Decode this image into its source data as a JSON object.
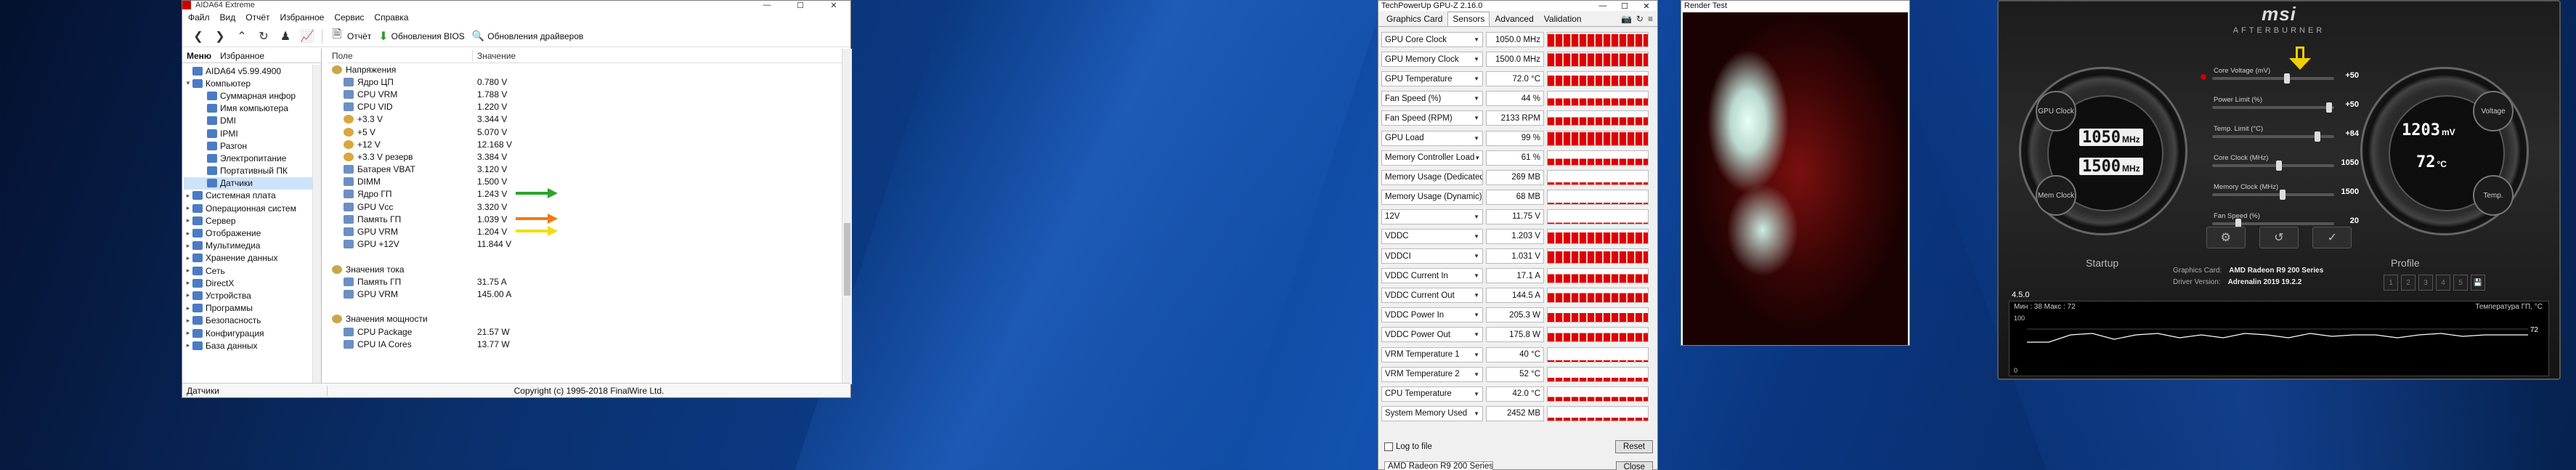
{
  "aida": {
    "title": "AIDA64 Extreme",
    "menu": [
      "Файл",
      "Вид",
      "Отчёт",
      "Избранное",
      "Сервис",
      "Справка"
    ],
    "toolbar": {
      "report": "Отчёт",
      "bios": "Обновления BIOS",
      "drivers": "Обновления драйверов"
    },
    "tabs": [
      "Меню",
      "Избранное"
    ],
    "tree": [
      {
        "label": "AIDA64 v5.99.4900",
        "exp": ""
      },
      {
        "label": "Компьютер",
        "exp": "▾"
      },
      {
        "label": "Суммарная инфор",
        "exp": "",
        "indent": 2
      },
      {
        "label": "Имя компьютера",
        "exp": "",
        "indent": 2
      },
      {
        "label": "DMI",
        "exp": "",
        "indent": 2
      },
      {
        "label": "IPMI",
        "exp": "",
        "indent": 2
      },
      {
        "label": "Разгон",
        "exp": "",
        "indent": 2
      },
      {
        "label": "Электропитание",
        "exp": "",
        "indent": 2
      },
      {
        "label": "Портативный ПК",
        "exp": "",
        "indent": 2
      },
      {
        "label": "Датчики",
        "exp": "",
        "indent": 2,
        "selected": true
      },
      {
        "label": "Системная плата",
        "exp": "▸"
      },
      {
        "label": "Операционная систем",
        "exp": "▸"
      },
      {
        "label": "Сервер",
        "exp": "▸"
      },
      {
        "label": "Отображение",
        "exp": "▸"
      },
      {
        "label": "Мультимедиа",
        "exp": "▸"
      },
      {
        "label": "Хранение данных",
        "exp": "▸"
      },
      {
        "label": "Сеть",
        "exp": "▸"
      },
      {
        "label": "DirectX",
        "exp": "▸"
      },
      {
        "label": "Устройства",
        "exp": "▸"
      },
      {
        "label": "Программы",
        "exp": "▸"
      },
      {
        "label": "Безопасность",
        "exp": "▸"
      },
      {
        "label": "Конфигурация",
        "exp": "▸"
      },
      {
        "label": "База данных",
        "exp": "▸"
      }
    ],
    "columns": {
      "field": "Поле",
      "value": "Значение"
    },
    "rows": [
      {
        "type": "sec",
        "field": "Напряжения",
        "value": ""
      },
      {
        "field": "Ядро ЦП",
        "value": "0.780 V"
      },
      {
        "field": "CPU VRM",
        "value": "1.788 V"
      },
      {
        "field": "CPU VID",
        "value": "1.220 V"
      },
      {
        "field": "+3.3 V",
        "value": "3.344 V",
        "orb": true
      },
      {
        "field": "+5 V",
        "value": "5.070 V",
        "orb": true
      },
      {
        "field": "+12 V",
        "value": "12.168 V",
        "orb": true
      },
      {
        "field": "+3.3 V резерв",
        "value": "3.384 V",
        "orb": true
      },
      {
        "field": "Батарея VBAT",
        "value": "3.120 V"
      },
      {
        "field": "DIMM",
        "value": "1.500 V"
      },
      {
        "field": "Ядро ГП",
        "value": "1.243 V",
        "arrow": "#2aa52a"
      },
      {
        "field": "GPU Vcc",
        "value": "3.320 V"
      },
      {
        "field": "Память ГП",
        "value": "1.039 V",
        "arrow": "#f07a10"
      },
      {
        "field": "GPU VRM",
        "value": "1.204 V",
        "arrow": "#f2dd10"
      },
      {
        "field": "GPU +12V",
        "value": "11.844 V"
      },
      {
        "type": "blank",
        "field": "",
        "value": ""
      },
      {
        "type": "sec",
        "field": "Значения тока",
        "value": ""
      },
      {
        "field": "Память ГП",
        "value": "31.75 A"
      },
      {
        "field": "GPU VRM",
        "value": "145.00 A"
      },
      {
        "type": "blank",
        "field": "",
        "value": ""
      },
      {
        "type": "sec",
        "field": "Значения мощности",
        "value": ""
      },
      {
        "field": "CPU Package",
        "value": "21.57 W"
      },
      {
        "field": "CPU IA Cores",
        "value": "13.77 W"
      }
    ],
    "status": {
      "left": "Датчики",
      "center": "Copyright (c) 1995-2018 FinalWire Ltd."
    }
  },
  "gpuz": {
    "title": "TechPowerUp GPU-Z 2.16.0",
    "tabs": [
      "Graphics Card",
      "Sensors",
      "Advanced",
      "Validation"
    ],
    "active_tab": "Sensors",
    "sensors": [
      {
        "name": "GPU Core Clock",
        "value": "1050.0 MHz",
        "level": 90
      },
      {
        "name": "GPU Memory Clock",
        "value": "1500.0 MHz",
        "level": 92
      },
      {
        "name": "GPU Temperature",
        "value": "72.0 °C",
        "level": 75
      },
      {
        "name": "Fan Speed (%)",
        "value": "44 %",
        "level": 50
      },
      {
        "name": "Fan Speed (RPM)",
        "value": "2133 RPM",
        "level": 55
      },
      {
        "name": "GPU Load",
        "value": "99 %",
        "level": 95
      },
      {
        "name": "Memory Controller Load",
        "value": "61 %",
        "level": 45
      },
      {
        "name": "Memory Usage (Dedicated)",
        "value": "269 MB",
        "level": 15
      },
      {
        "name": "Memory Usage (Dynamic)",
        "value": "68 MB",
        "level": 10
      },
      {
        "name": "12V",
        "value": "11.75 V",
        "level": 8
      },
      {
        "name": "VDDC",
        "value": "1.203 V",
        "level": 80
      },
      {
        "name": "VDDCI",
        "value": "1.031 V",
        "level": 85
      },
      {
        "name": "VDDC Current In",
        "value": "17.1 A",
        "level": 60
      },
      {
        "name": "VDDC Current Out",
        "value": "144.5 A",
        "level": 65
      },
      {
        "name": "VDDC Power In",
        "value": "205.3 W",
        "level": 62
      },
      {
        "name": "VDDC Power Out",
        "value": "175.8 W",
        "level": 60
      },
      {
        "name": "VRM Temperature 1",
        "value": "40 °C",
        "level": 10
      },
      {
        "name": "VRM Temperature 2",
        "value": "52 °C",
        "level": 25
      },
      {
        "name": "CPU Temperature",
        "value": "42.0 °C",
        "level": 30
      },
      {
        "name": "System Memory Used",
        "value": "2452 MB",
        "level": 20
      }
    ],
    "log_label": "Log to file",
    "reset": "Reset",
    "card_select": "AMD Radeon R9 200 Series",
    "close": "Close"
  },
  "render": {
    "title": "Render Test"
  },
  "afterburner": {
    "logo": "msi",
    "brand": "AFTERBURNER",
    "gpu_clock_label": "GPU Clock",
    "mem_clock_label": "Mem Clock",
    "voltage_label": "Voltage",
    "temp_label": "Temp.",
    "gpu_clock": "1050",
    "gpu_clock_unit": "MHz",
    "mem_clock": "1500",
    "mem_clock_unit": "MHz",
    "voltage": "1203",
    "voltage_unit": "mV",
    "temp": "72",
    "temp_unit": "°C",
    "sliders": [
      {
        "name": "Core Voltage (mV)",
        "value": "+50",
        "pos": 0.62
      },
      {
        "name": "Power Limit (%)",
        "value": "+50",
        "pos": 0.98
      },
      {
        "name": "Temp. Limit (°C)",
        "value": "+84",
        "pos": 0.88
      },
      {
        "name": "Core Clock (MHz)",
        "value": "1050",
        "pos": 0.55
      },
      {
        "name": "Memory Clock (MHz)",
        "value": "1500",
        "pos": 0.58
      },
      {
        "name": "Fan Speed (%)",
        "value": "20",
        "pos": 0.2
      }
    ],
    "startup": "Startup",
    "profile": "Profile",
    "graphics_card_label": "Graphics Card:",
    "graphics_card": "AMD Radeon R9 200 Series",
    "driver_label": "Driver Version:",
    "driver": "Adrenalin 2019 19.2.2",
    "profile_slots": [
      "1",
      "2",
      "3",
      "4",
      "5"
    ],
    "version": "4.5.0",
    "monitor": {
      "min_max": "Мин : 38   Макс : 72",
      "title": "Температура ГП, °С",
      "y_top": "100",
      "y_bottom": "0",
      "current": "72"
    }
  }
}
